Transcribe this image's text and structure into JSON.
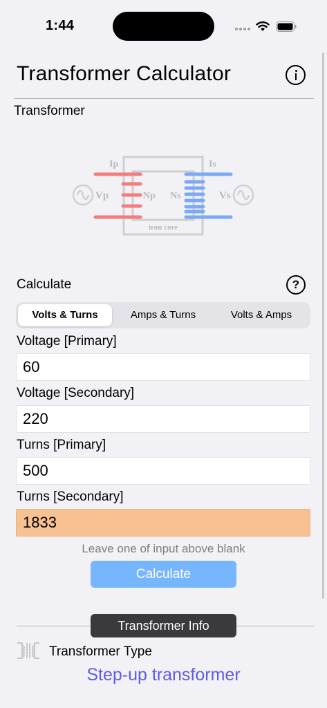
{
  "status_bar": {
    "time": "1:44"
  },
  "header": {
    "title": "Transformer Calculator"
  },
  "transformer_section": {
    "label": "Transformer"
  },
  "diagram": {
    "ip": "Ip",
    "is": "Is",
    "vp": "Vp",
    "vs": "Vs",
    "np": "Np",
    "ns": "Ns",
    "core": "iron core",
    "primary_color": "#f47c7c",
    "secondary_color": "#7aaaf5"
  },
  "calculate_section": {
    "label": "Calculate",
    "modes": [
      "Volts & Turns",
      "Amps & Turns",
      "Volts & Amps"
    ],
    "selected_mode": 0
  },
  "fields": [
    {
      "label": "Voltage [Primary]",
      "value": "60"
    },
    {
      "label": "Voltage [Secondary]",
      "value": "220"
    },
    {
      "label": "Turns [Primary]",
      "value": "500"
    },
    {
      "label": "Turns [Secondary]",
      "value": "1833"
    }
  ],
  "hint": "Leave one of input above blank",
  "calculate_button": "Calculate",
  "info": {
    "pill": "Transformer Info",
    "type_label": "Transformer Type",
    "type_value": "Step-up transformer"
  },
  "colors": {
    "accent": "#5e5ce6",
    "button": "#76b6fd",
    "result_bg": "#f7c192"
  }
}
